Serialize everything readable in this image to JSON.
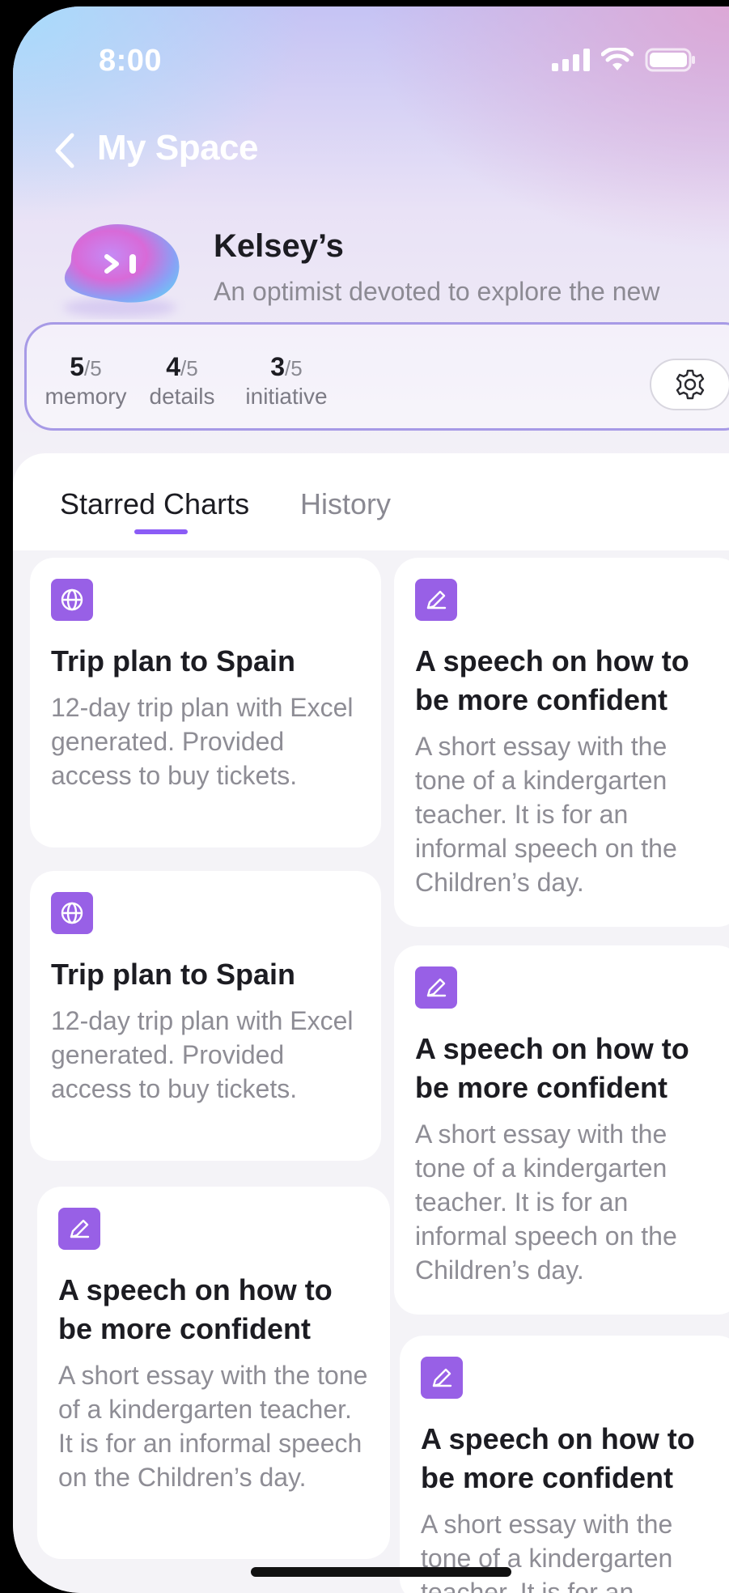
{
  "status_bar": {
    "time": "8:00"
  },
  "header": {
    "title": "My Space"
  },
  "profile": {
    "name": "Kelsey’s",
    "description": "An optimist devoted to explore the new"
  },
  "stats": [
    {
      "value": "5",
      "max": "/5",
      "label": "memory"
    },
    {
      "value": "4",
      "max": "/5",
      "label": "details"
    },
    {
      "value": "3",
      "max": "/5",
      "label": "initiative"
    }
  ],
  "tabs": [
    {
      "label": "Starred Charts",
      "active": true
    },
    {
      "label": "History",
      "active": false
    }
  ],
  "cards": [
    {
      "icon": "globe-icon",
      "title": "Trip plan to Spain",
      "description": "12-day trip plan with Excel generated. Provided access to buy tickets."
    },
    {
      "icon": "pen-icon",
      "title": "A speech on how to be more confident",
      "description": "A short essay with the tone of a kindergarten teacher. It is for an informal speech on the Children’s day."
    },
    {
      "icon": "globe-icon",
      "title": "Trip plan to Spain",
      "description": "12-day trip plan with Excel generated. Provided access to buy tickets."
    },
    {
      "icon": "pen-icon",
      "title": "A speech on how to be more confident",
      "description": "A short essay with the tone of a kindergarten teacher. It is for an informal speech on the Children’s day."
    },
    {
      "icon": "pen-icon",
      "title": "A speech on how to be more confident",
      "description": "A short essay with the tone of a kindergarten teacher. It is for an informal speech on the Children’s day."
    },
    {
      "icon": "pen-icon",
      "title": "A speech on how to be more confident",
      "description": "A short essay with the tone of a kindergarten teacher. It is for an"
    }
  ],
  "colors": {
    "accent": "#9860e6",
    "stats_border": "#a79ae6"
  }
}
